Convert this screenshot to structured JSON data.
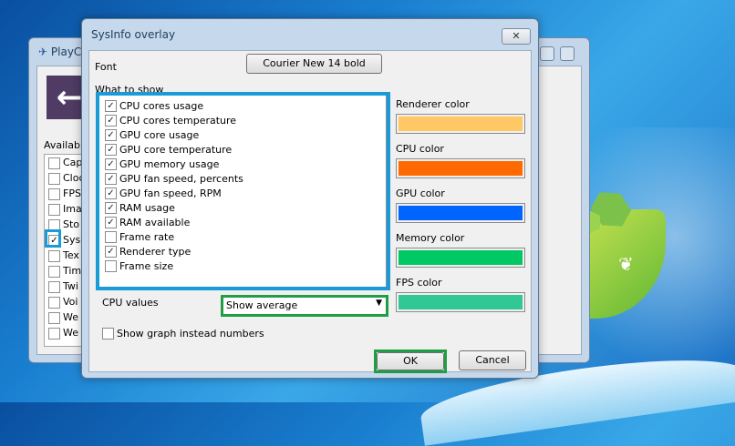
{
  "back_window": {
    "title": "PlayC",
    "available_label": "Available",
    "items": [
      {
        "label": "Cap",
        "checked": false
      },
      {
        "label": "Cloc",
        "checked": false
      },
      {
        "label": "FPS",
        "checked": false
      },
      {
        "label": "Ima",
        "checked": false
      },
      {
        "label": "Sto",
        "checked": false
      },
      {
        "label": "Sys",
        "checked": true
      },
      {
        "label": "Tex",
        "checked": false
      },
      {
        "label": "Tim",
        "checked": false
      },
      {
        "label": "Twi",
        "checked": false
      },
      {
        "label": "Voi",
        "checked": false
      },
      {
        "label": "We",
        "checked": false
      },
      {
        "label": "We",
        "checked": false
      }
    ]
  },
  "dialog": {
    "title": "SysInfo overlay",
    "close_glyph": "✕",
    "font_label": "Font",
    "font_button": "Courier New 14 bold",
    "what_to_show_label": "What to show",
    "items": [
      {
        "label": "CPU cores usage",
        "checked": true
      },
      {
        "label": "CPU cores temperature",
        "checked": true
      },
      {
        "label": "GPU core usage",
        "checked": true
      },
      {
        "label": "GPU core temperature",
        "checked": true
      },
      {
        "label": "GPU memory usage",
        "checked": true
      },
      {
        "label": "GPU fan speed, percents",
        "checked": true
      },
      {
        "label": "GPU fan speed, RPM",
        "checked": true
      },
      {
        "label": "RAM usage",
        "checked": true
      },
      {
        "label": "RAM available",
        "checked": true
      },
      {
        "label": "Frame rate",
        "checked": false
      },
      {
        "label": "Renderer type",
        "checked": true
      },
      {
        "label": "Frame size",
        "checked": false
      }
    ],
    "colors": [
      {
        "label": "Renderer color",
        "value": "#ffc864"
      },
      {
        "label": "CPU color",
        "value": "#ff6a00"
      },
      {
        "label": "GPU color",
        "value": "#0064ff"
      },
      {
        "label": "Memory color",
        "value": "#00c864"
      },
      {
        "label": "FPS color",
        "value": "#32c896"
      }
    ],
    "cpu_values_label": "CPU values",
    "cpu_values_selected": "Show average",
    "show_graph_label": "Show graph instead numbers",
    "show_graph_checked": false,
    "ok_label": "OK",
    "cancel_label": "Cancel"
  },
  "check_glyph": "✓",
  "highlight_colors": {
    "blue": "#1a9ad6",
    "green": "#1f9e46"
  }
}
